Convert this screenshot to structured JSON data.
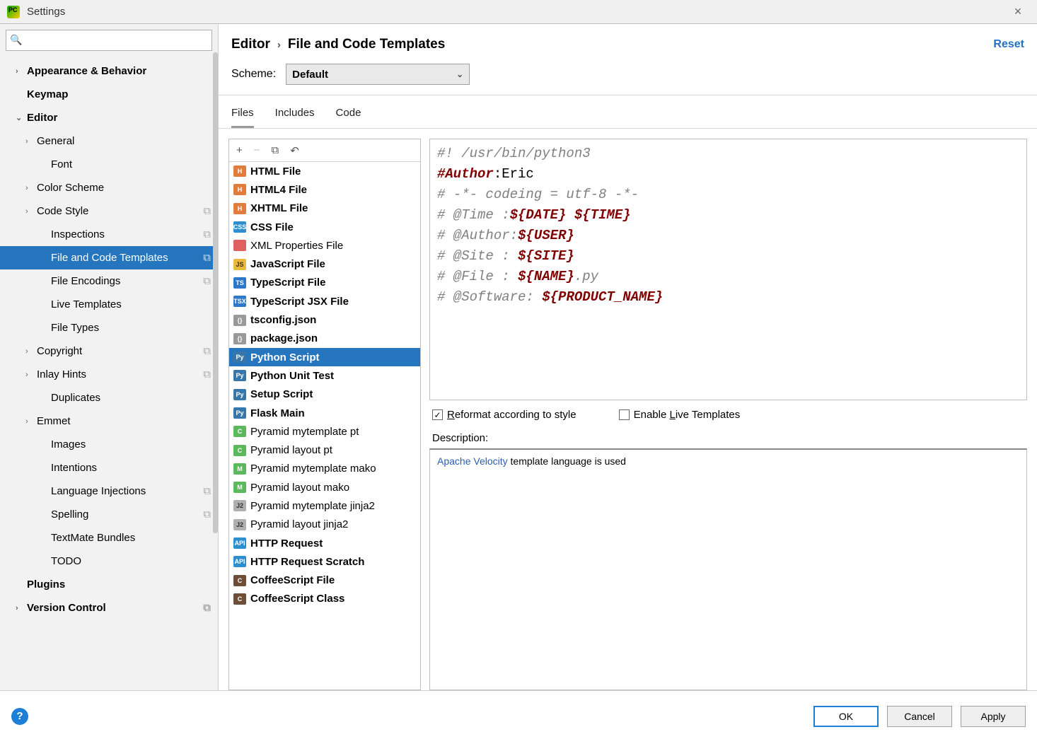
{
  "window": {
    "title": "Settings"
  },
  "search": {
    "placeholder": ""
  },
  "nav": [
    {
      "label": "Appearance & Behavior",
      "bold": true,
      "arrow": "›",
      "lvl": 0
    },
    {
      "label": "Keymap",
      "bold": true,
      "arrow": "",
      "lvl": 0
    },
    {
      "label": "Editor",
      "bold": true,
      "arrow": "⌄",
      "lvl": 0
    },
    {
      "label": "General",
      "arrow": "›",
      "lvl": 1
    },
    {
      "label": "Font",
      "arrow": "",
      "lvl": 2
    },
    {
      "label": "Color Scheme",
      "arrow": "›",
      "lvl": 1
    },
    {
      "label": "Code Style",
      "arrow": "›",
      "lvl": 1,
      "pill": true
    },
    {
      "label": "Inspections",
      "arrow": "",
      "lvl": 2,
      "pill": true
    },
    {
      "label": "File and Code Templates",
      "arrow": "",
      "lvl": 2,
      "pill": true,
      "selected": true
    },
    {
      "label": "File Encodings",
      "arrow": "",
      "lvl": 2,
      "pill": true
    },
    {
      "label": "Live Templates",
      "arrow": "",
      "lvl": 2
    },
    {
      "label": "File Types",
      "arrow": "",
      "lvl": 2
    },
    {
      "label": "Copyright",
      "arrow": "›",
      "lvl": 1,
      "pill": true
    },
    {
      "label": "Inlay Hints",
      "arrow": "›",
      "lvl": 1,
      "pill": true
    },
    {
      "label": "Duplicates",
      "arrow": "",
      "lvl": 2
    },
    {
      "label": "Emmet",
      "arrow": "›",
      "lvl": 1
    },
    {
      "label": "Images",
      "arrow": "",
      "lvl": 2
    },
    {
      "label": "Intentions",
      "arrow": "",
      "lvl": 2
    },
    {
      "label": "Language Injections",
      "arrow": "",
      "lvl": 2,
      "pill": true
    },
    {
      "label": "Spelling",
      "arrow": "",
      "lvl": 2,
      "pill": true
    },
    {
      "label": "TextMate Bundles",
      "arrow": "",
      "lvl": 2
    },
    {
      "label": "TODO",
      "arrow": "",
      "lvl": 2
    },
    {
      "label": "Plugins",
      "bold": true,
      "arrow": "",
      "lvl": 0
    },
    {
      "label": "Version Control",
      "bold": true,
      "arrow": "›",
      "lvl": 0,
      "pill": true
    }
  ],
  "breadcrumb": {
    "root": "Editor",
    "leaf": "File and Code Templates"
  },
  "reset_label": "Reset",
  "scheme": {
    "label": "Scheme:",
    "value": "Default"
  },
  "tabs": [
    "Files",
    "Includes",
    "Code"
  ],
  "active_tab": 0,
  "toolbar": {
    "add": "+",
    "remove": "−",
    "copy": "⧉",
    "undo": "↶"
  },
  "templates": [
    {
      "ico": "h",
      "txt": "H",
      "label": "HTML File",
      "bold": true
    },
    {
      "ico": "h",
      "txt": "H",
      "label": "HTML4 File",
      "bold": true
    },
    {
      "ico": "h",
      "txt": "H",
      "label": "XHTML File",
      "bold": true
    },
    {
      "ico": "css",
      "txt": "CSS",
      "label": "CSS File",
      "bold": true
    },
    {
      "ico": "xml",
      "txt": "</>",
      "label": "XML Properties File"
    },
    {
      "ico": "js",
      "txt": "JS",
      "label": "JavaScript File",
      "bold": true
    },
    {
      "ico": "ts",
      "txt": "TS",
      "label": "TypeScript File",
      "bold": true
    },
    {
      "ico": "tsx",
      "txt": "TSX",
      "label": "TypeScript JSX File",
      "bold": true
    },
    {
      "ico": "json",
      "txt": "{}",
      "label": "tsconfig.json",
      "bold": true
    },
    {
      "ico": "json",
      "txt": "{}",
      "label": "package.json",
      "bold": true
    },
    {
      "ico": "py",
      "txt": "Py",
      "label": "Python Script",
      "bold": true,
      "selected": true
    },
    {
      "ico": "py",
      "txt": "Py",
      "label": "Python Unit Test",
      "bold": true
    },
    {
      "ico": "py",
      "txt": "Py",
      "label": "Setup Script",
      "bold": true
    },
    {
      "ico": "py",
      "txt": "Py",
      "label": "Flask Main",
      "bold": true
    },
    {
      "ico": "c",
      "txt": "C",
      "label": "Pyramid mytemplate pt"
    },
    {
      "ico": "c",
      "txt": "C",
      "label": "Pyramid layout pt"
    },
    {
      "ico": "m",
      "txt": "M",
      "label": "Pyramid mytemplate mako"
    },
    {
      "ico": "m",
      "txt": "M",
      "label": "Pyramid layout mako"
    },
    {
      "ico": "j2",
      "txt": "J2",
      "label": "Pyramid mytemplate jinja2"
    },
    {
      "ico": "j2",
      "txt": "J2",
      "label": "Pyramid layout jinja2"
    },
    {
      "ico": "api",
      "txt": "API",
      "label": "HTTP Request",
      "bold": true
    },
    {
      "ico": "api",
      "txt": "API",
      "label": "HTTP Request Scratch",
      "bold": true
    },
    {
      "ico": "cof",
      "txt": "C",
      "label": "CoffeeScript File",
      "bold": true
    },
    {
      "ico": "cof",
      "txt": "C",
      "label": "CoffeeScript Class",
      "bold": true
    }
  ],
  "code": {
    "l1a": "#! /usr/bin/python3",
    "l2a": "#Author",
    "l2b": ":Eric",
    "l3": "# -*- codeing = utf-8 -*-",
    "l4a": "# @Time :",
    "l4b": "${DATE} ${TIME}",
    "l5a": "# @Author:",
    "l5b": "${USER}",
    "l6a": "# @Site : ",
    "l6b": "${SITE}",
    "l7a": "# @File : ",
    "l7b": "${NAME}",
    "l7c": ".py",
    "l8a": "# @Software: ",
    "l8b": "${PRODUCT_NAME}"
  },
  "options": {
    "reformat": {
      "checked": true,
      "label_pre": "R",
      "label_rest": "eformat according to style"
    },
    "live": {
      "checked": false,
      "label": "Enable ",
      "u": "L",
      "rest": "ive Templates"
    }
  },
  "description": {
    "label": "Description:",
    "link": "Apache Velocity",
    "rest": " template language is used"
  },
  "buttons": {
    "ok": "OK",
    "cancel": "Cancel",
    "apply": "Apply"
  }
}
